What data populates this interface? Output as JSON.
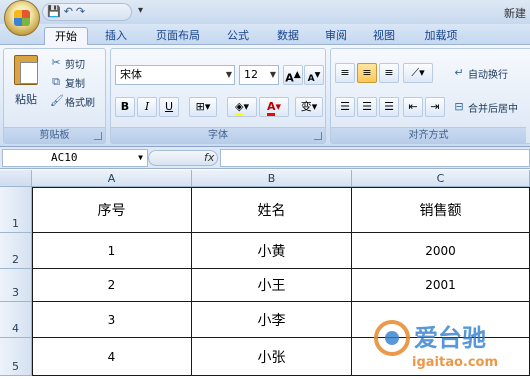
{
  "window": {
    "title": "新建",
    "quick_access": [
      "💾",
      "↶",
      "↷"
    ]
  },
  "tabs": [
    "开始",
    "插入",
    "页面布局",
    "公式",
    "数据",
    "审阅",
    "视图",
    "加载项"
  ],
  "active_tab": "开始",
  "clipboard": {
    "paste": "粘贴",
    "cut": "剪切",
    "copy": "复制",
    "format_painter": "格式刷",
    "group_label": "剪贴板"
  },
  "font": {
    "name": "宋体",
    "size": "12",
    "grow": "A",
    "shrink": "A",
    "bold": "B",
    "italic": "I",
    "underline": "U",
    "font_color_letter": "A",
    "phonetic": "变",
    "group_label": "字体"
  },
  "alignment": {
    "wrap_text": "自动换行",
    "merge_center": "合并后居中",
    "group_label": "对齐方式"
  },
  "formula_bar": {
    "name_box": "AC10",
    "fx": "fx",
    "formula": ""
  },
  "columns": [
    "A",
    "B",
    "C"
  ],
  "rows": [
    "1",
    "2",
    "3",
    "4",
    "5"
  ],
  "table": {
    "headers": [
      "序号",
      "姓名",
      "销售额"
    ],
    "rows": [
      [
        "1",
        "小黄",
        "2000"
      ],
      [
        "2",
        "小王",
        "2001"
      ],
      [
        "3",
        "小李",
        ""
      ],
      [
        "4",
        "小张",
        ""
      ]
    ]
  },
  "watermark": {
    "text": "爱台驰",
    "url": "igaitao.com"
  },
  "colors": {
    "ribbon_bg": "#dde8f6",
    "tab_text": "#15428b",
    "grid_border": "#1a1a1a",
    "header_bg": "#d5e1f1"
  }
}
